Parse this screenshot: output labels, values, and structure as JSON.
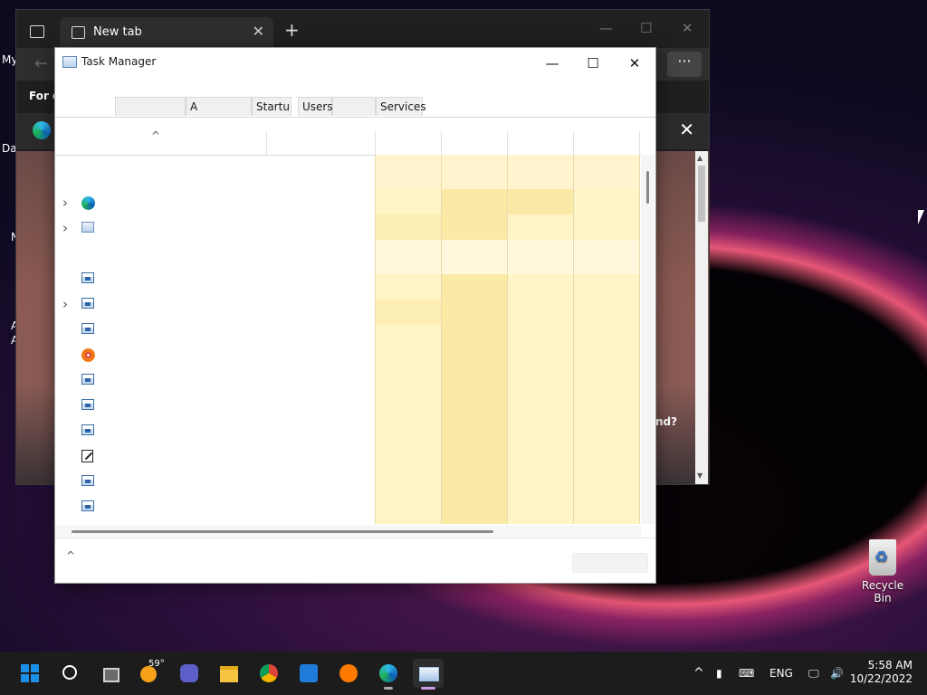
{
  "desktop": {
    "partial_labels": [
      "My",
      "Da",
      "N",
      "A",
      "A"
    ],
    "recycle_bin_label": "Recycle Bin"
  },
  "browser": {
    "tab_title": "New tab",
    "toolbar_more": "···",
    "hint_text": "For q",
    "partial_text": "nd?"
  },
  "task_manager": {
    "title": "Task Manager",
    "tabs": [
      "",
      "",
      "A",
      "Startu",
      "Users",
      "",
      "Services"
    ],
    "rows": [
      {
        "icon": "none",
        "expandable": false
      },
      {
        "icon": "edge-icon",
        "expandable": true
      },
      {
        "icon": "task-manager-icon",
        "expandable": true
      },
      {
        "icon": "none",
        "expandable": false
      },
      {
        "icon": "process-icon",
        "expandable": false
      },
      {
        "icon": "process-icon",
        "expandable": true
      },
      {
        "icon": "process-icon",
        "expandable": false
      },
      {
        "icon": "avast-icon",
        "expandable": false
      },
      {
        "icon": "process-icon",
        "expandable": false
      },
      {
        "icon": "process-icon",
        "expandable": false
      },
      {
        "icon": "process-icon",
        "expandable": false
      },
      {
        "icon": "notepad-icon",
        "expandable": false
      },
      {
        "icon": "process-icon",
        "expandable": false
      },
      {
        "icon": "process-icon",
        "expandable": false
      }
    ],
    "heat_color": "#fff4c6"
  },
  "taskbar": {
    "weather_temp": "59°",
    "language": "ENG",
    "time": "5:58 AM",
    "date": "10/22/2022",
    "apps": [
      "start",
      "search",
      "task-view",
      "weather",
      "teams-chat",
      "file-explorer",
      "chrome",
      "app-installer",
      "avast",
      "edge",
      "task-manager"
    ],
    "active_app": "task-manager"
  },
  "colors": {
    "accent": "#1c8fe6",
    "taskbar_bg": "#1c1c1c"
  }
}
